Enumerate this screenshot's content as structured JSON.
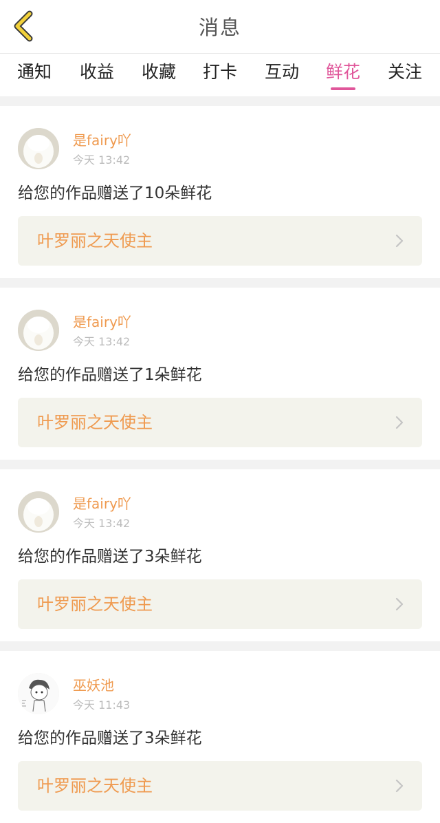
{
  "header": {
    "title": "消息"
  },
  "tabs": [
    {
      "label": "通知",
      "active": false
    },
    {
      "label": "收益",
      "active": false
    },
    {
      "label": "收藏",
      "active": false
    },
    {
      "label": "打卡",
      "active": false
    },
    {
      "label": "互动",
      "active": false
    },
    {
      "label": "鲜花",
      "active": true
    },
    {
      "label": "关注",
      "active": false
    }
  ],
  "colors": {
    "accent": "#e0569a",
    "username": "#ef9a4f",
    "work_title": "#ef9a4f",
    "work_box_bg": "#f3f3ec",
    "separator": "#f2f2f2"
  },
  "messages": [
    {
      "username": "是fairy吖",
      "time": "今天 13:42",
      "text": "给您的作品赠送了10朵鲜花",
      "work_title": "叶罗丽之天使主",
      "avatar": "white-fluffy-avatar"
    },
    {
      "username": "是fairy吖",
      "time": "今天 13:42",
      "text": "给您的作品赠送了1朵鲜花",
      "work_title": "叶罗丽之天使主",
      "avatar": "white-fluffy-avatar"
    },
    {
      "username": "是fairy吖",
      "time": "今天 13:42",
      "text": "给您的作品赠送了3朵鲜花",
      "work_title": "叶罗丽之天使主",
      "avatar": "white-fluffy-avatar"
    },
    {
      "username": "巫妖池",
      "time": "今天 11:43",
      "text": "给您的作品赠送了3朵鲜花",
      "work_title": "叶罗丽之天使主",
      "avatar": "sketch-boy-avatar"
    }
  ]
}
